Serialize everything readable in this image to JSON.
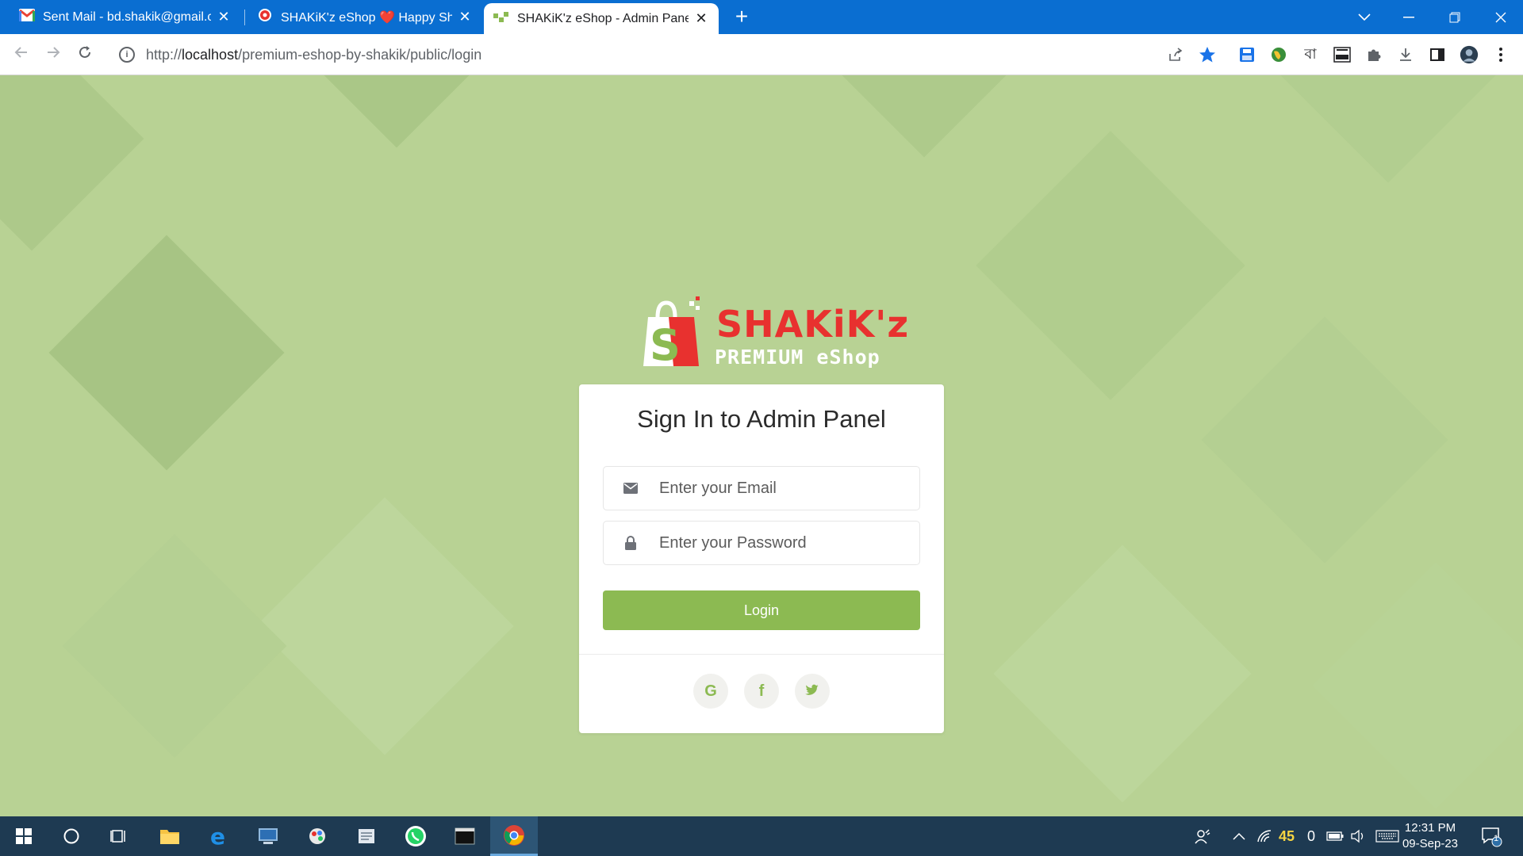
{
  "browser": {
    "tabs": [
      {
        "title": "Sent Mail - bd.shakik@gmail.com",
        "icon": "gmail-icon"
      },
      {
        "title": "SHAKiK'z eShop ❤️ Happy Shopping",
        "icon": "gear-icon"
      },
      {
        "title": "SHAKiK'z eShop - Admin Panel",
        "icon": "eshop-icon"
      }
    ],
    "url_prefix": "http://",
    "url_host": "localhost",
    "url_path": "/premium-eshop-by-shakik/public/login",
    "ext_bangla_label": "বা"
  },
  "logo": {
    "brand": "SHAKiK'z",
    "tagline": "PREMIUM eShop",
    "brand_color": "#e8312f",
    "accent_color": "#8cba52"
  },
  "login": {
    "title": "Sign In to Admin Panel",
    "email_placeholder": "Enter your Email",
    "password_placeholder": "Enter your Password",
    "button_label": "Login",
    "social": [
      "G",
      "f",
      "twitter"
    ]
  },
  "taskbar": {
    "tray_numbers": {
      "a": "45",
      "b": "0"
    },
    "time": "12:31 PM",
    "date": "09-Sep-23",
    "notification_count": "1"
  }
}
